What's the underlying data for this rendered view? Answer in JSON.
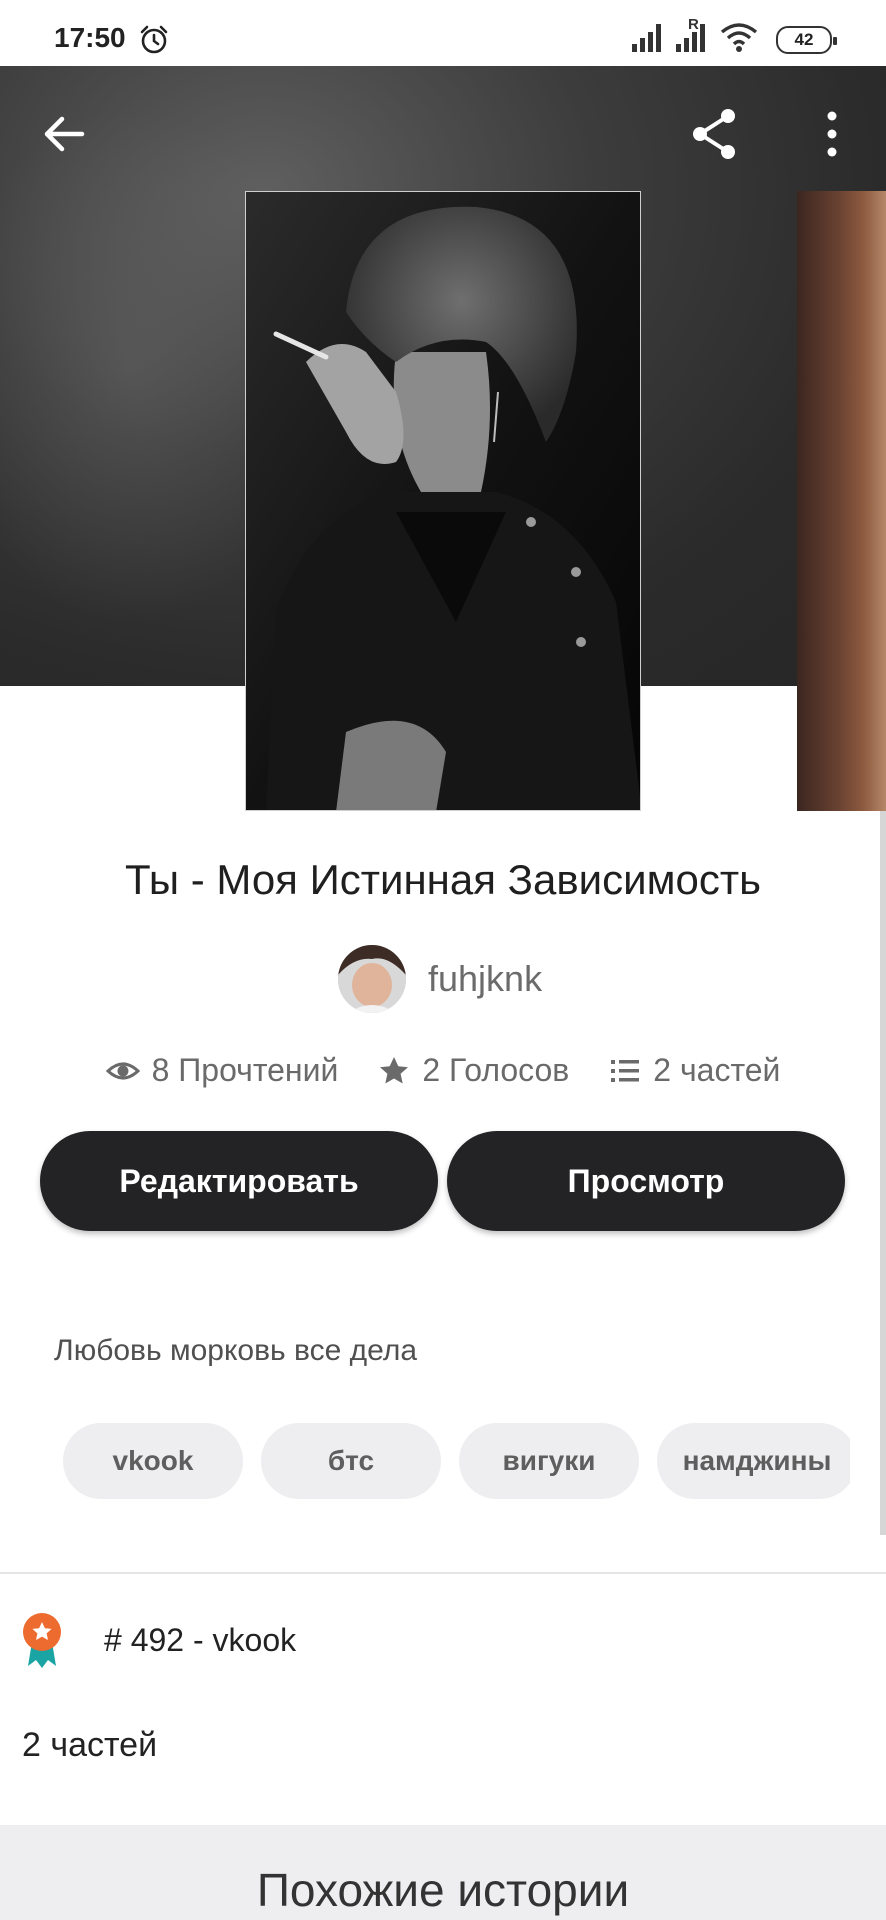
{
  "status_bar": {
    "time": "17:50",
    "network_label": "R",
    "battery": "42"
  },
  "story": {
    "title": "Ты - Моя Истинная Зависимость",
    "author": "fuhjknk",
    "stats": {
      "reads": "8 Прочтений",
      "votes": "2 Голосов",
      "parts": "2 частей"
    },
    "description": "Любовь морковь все дела",
    "tags": [
      "vkook",
      "бтс",
      "вигуки",
      "намджины"
    ],
    "rank": "# 492 - vkook",
    "parts_count": "2 частей"
  },
  "buttons": {
    "edit": "Редактировать",
    "view": "Просмотр"
  },
  "similar_section": {
    "title": "Похожие истории"
  },
  "colors": {
    "button_bg": "#232224",
    "tag_bg": "#eeedef",
    "hero_bg": "#2b2b2b",
    "rank_badge": "#ee6b2f",
    "ribbon": "#1aa4a4"
  }
}
